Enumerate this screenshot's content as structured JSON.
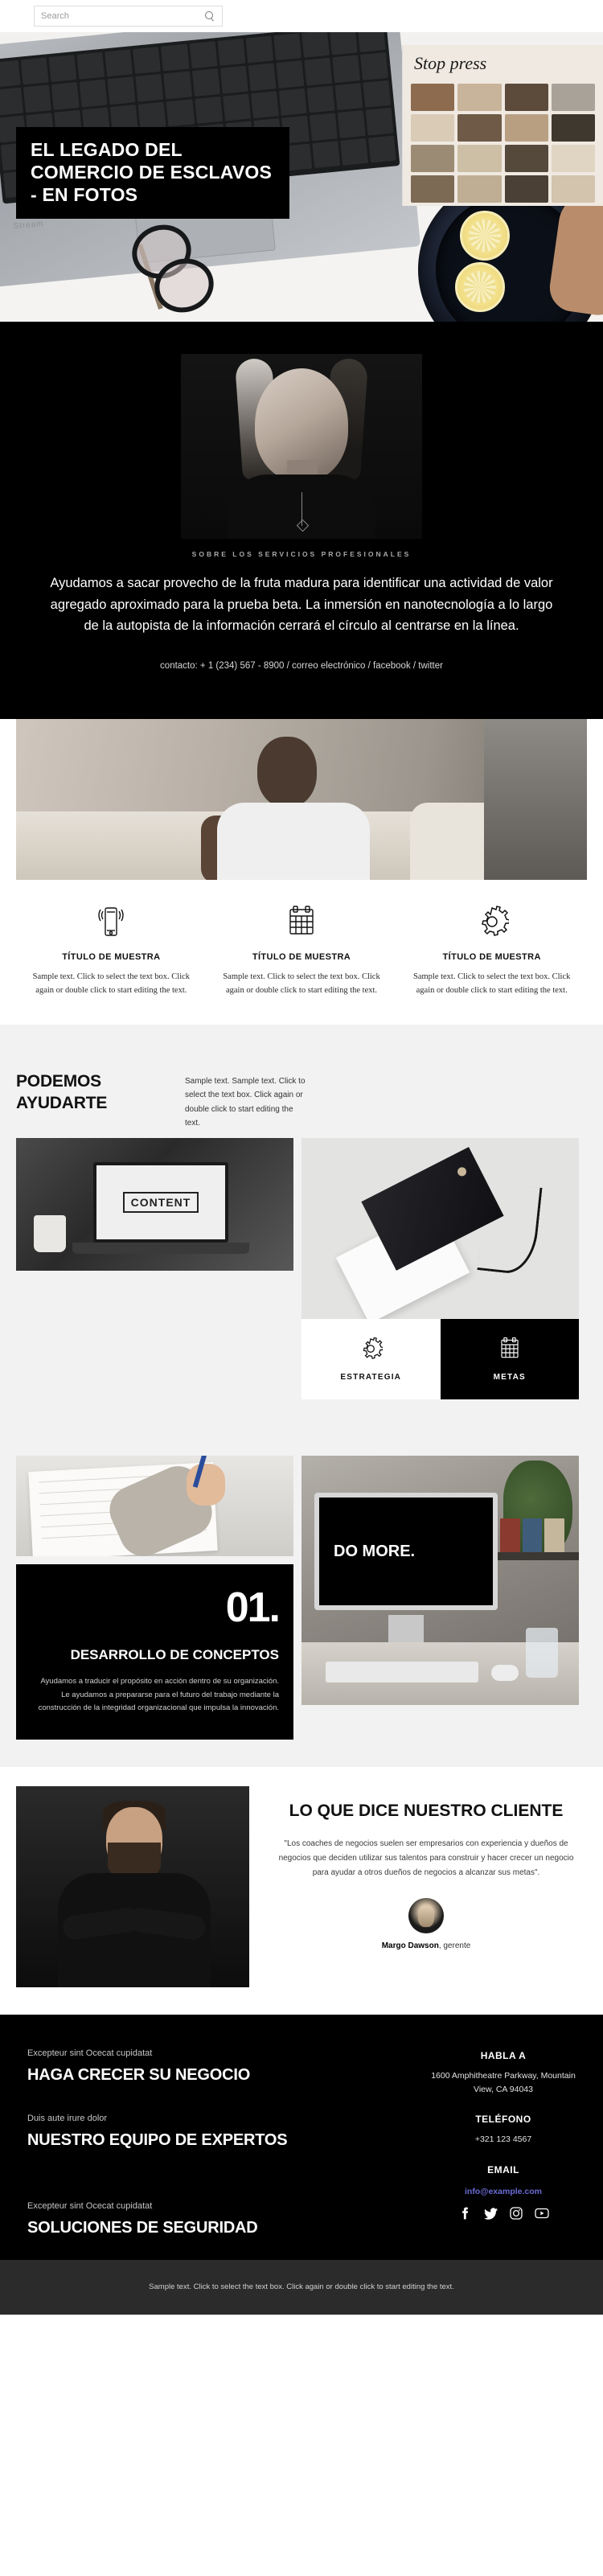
{
  "search": {
    "placeholder": "Search",
    "icon": "search-icon"
  },
  "hero": {
    "title": "EL LEGADO DEL COMERCIO DE ESCLAVOS - EN FOTOS",
    "magazine_headline": "Stop press"
  },
  "about": {
    "eyebrow": "SOBRE LOS SERVICIOS PROFESIONALES",
    "lead": "Ayudamos a sacar provecho de la fruta madura para identificar una actividad de valor agregado aproximado para la prueba beta. La inmersión en nanotecnología a lo largo de la autopista de la información cerrará el círculo al centrarse en la línea.",
    "contact": "contacto: + 1 (234) 567 - 8900 / correo electrónico / facebook / twitter"
  },
  "features": [
    {
      "icon": "mobile-signal-icon",
      "title": "TÍTULO DE MUESTRA",
      "text": "Sample text. Click to select the text box. Click again or double click to start editing the text."
    },
    {
      "icon": "calendar-icon",
      "title": "TÍTULO DE MUESTRA",
      "text": "Sample text. Click to select the text box. Click again or double click to start editing the text."
    },
    {
      "icon": "gear-icon",
      "title": "TÍTULO DE MUESTRA",
      "text": "Sample text. Click to select the text box. Click again or double click to start editing the text."
    }
  ],
  "help": {
    "heading": "PODEMOS AYUDARTE",
    "text": "Sample text. Sample text. Click to select the text box. Click again or double click to start editing the text.",
    "screen_label": "CONTENT",
    "cards": [
      {
        "icon": "gear-icon",
        "label": "ESTRATEGIA"
      },
      {
        "icon": "calendar-icon",
        "label": "METAS"
      }
    ]
  },
  "concept": {
    "number": "01.",
    "heading": "DESARROLLO DE CONCEPTOS",
    "text": "Ayudamos a traducir el propósito en acción dentro de su organización. Le ayudamos a prepararse para el futuro del trabajo mediante la construcción de la integridad organizacional que impulsa la innovación.",
    "monitor_text": "DO MORE."
  },
  "testimonial": {
    "heading": "LO QUE DICE NUESTRO CLIENTE",
    "quote": "\"Los coaches de negocios suelen ser empresarios con experiencia y dueños de negocios que deciden utilizar sus talentos para construir y hacer crecer un negocio para ayudar a otros dueños de negocios a alcanzar sus metas\".",
    "author_name": "Margo Dawson",
    "author_role": ", gerente"
  },
  "footer": {
    "blocks": [
      {
        "small": "Excepteur sint Ocecat cupidatat",
        "heading": "HAGA CRECER SU NEGOCIO"
      },
      {
        "small": "Duis aute irure dolor",
        "heading": "NUESTRO EQUIPO DE EXPERTOS"
      },
      {
        "small": "Excepteur sint Ocecat cupidatat",
        "heading": "SOLUCIONES DE SEGURIDAD"
      }
    ],
    "contact": {
      "talk_title": "HABLA A",
      "address": "1600 Amphitheatre Parkway, Mountain View, CA 94043",
      "phone_title": "TELÉFONO",
      "phone": "+321 123 4567",
      "email_title": "EMAIL",
      "email": "info@example.com",
      "email_color": "#6b6bd6"
    },
    "social": [
      {
        "icon": "facebook-icon",
        "name": "facebook"
      },
      {
        "icon": "twitter-icon",
        "name": "twitter"
      },
      {
        "icon": "instagram-icon",
        "name": "instagram"
      },
      {
        "icon": "youtube-icon",
        "name": "youtube"
      }
    ],
    "bottom_text": "Sample text. Click to select the text box. Click again or double click to start editing the text."
  }
}
